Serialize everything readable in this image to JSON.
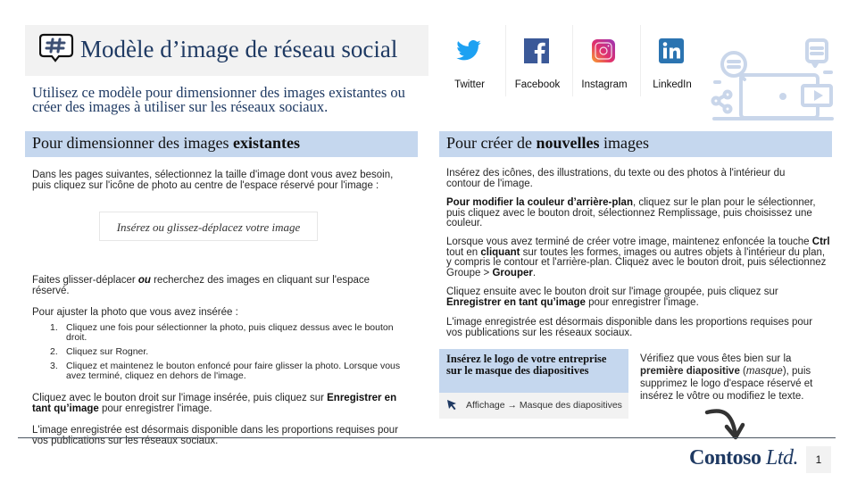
{
  "title": {
    "icon": "hashtag-speech-bubble-icon",
    "text": "Modèle d’image de réseau social"
  },
  "intro": "Utilisez ce modèle pour dimensionner des images existantes ou créer des images à utiliser sur les réseaux sociaux.",
  "left_section": {
    "header_prefix": "Pour dimensionner des images ",
    "header_bold": "existantes",
    "p1": "Dans les pages suivantes, sélectionnez la taille d'image dont vous avez besoin, puis cliquez sur l'icône de photo au centre de l'espace réservé pour l'image :",
    "placeholder_text": "Insérez ou glissez-déplacez votre image",
    "p2_before": "Faites glisser-déplacer ",
    "p2_emph": "ou",
    "p2_after": " recherchez des images en cliquant sur l'espace réservé.",
    "p3": "Pour ajuster la photo que vous avez insérée :",
    "steps": [
      {
        "num": "1.",
        "text": "Cliquez une fois pour sélectionner la photo, puis cliquez dessus avec le bouton droit."
      },
      {
        "num": "2.",
        "text": "Cliquez sur Rogner."
      },
      {
        "num": "3.",
        "text": "Cliquez et maintenez le bouton enfoncé pour faire glisser la photo. Lorsque vous avez terminé, cliquez en dehors de l'image."
      }
    ],
    "p4_before": "Cliquez avec le bouton droit sur l'image insérée, puis cliquez sur ",
    "p4_bold": "Enregistrer en tant qu’image",
    "p4_after": " pour enregistrer l'image.",
    "p5": "L'image enregistrée est désormais disponible dans les proportions requises pour vos publications sur les réseaux sociaux."
  },
  "social": [
    {
      "name": "Twitter",
      "icon": "twitter-icon",
      "color": "#1da1f2"
    },
    {
      "name": "Facebook",
      "icon": "facebook-icon",
      "color": "#3b5998"
    },
    {
      "name": "Instagram",
      "icon": "instagram-icon",
      "color": "#e1306c"
    },
    {
      "name": "LinkedIn",
      "icon": "linkedin-icon",
      "color": "#2b74b1"
    }
  ],
  "right_section": {
    "header_prefix": "Pour créer de ",
    "header_bold": "nouvelles",
    "header_suffix": " images",
    "p1": "Insérez des icônes, des illustrations, du texte ou des photos à l'intérieur du contour de l'image.",
    "p2_bold": "Pour modifier la couleur d’arrière-plan",
    "p2_after": ", cliquez sur le plan pour le sélectionner, puis cliquez avec le bouton droit, sélectionnez Remplissage, puis choisissez une couleur.",
    "p3_a": "Lorsque vous avez terminé de créer votre image, maintenez enfoncée la touche ",
    "p3_ctrl": "Ctrl",
    "p3_b": " tout en ",
    "p3_cliquant": "cliquant",
    "p3_c": " sur toutes les formes, images ou autres objets à l'intérieur du plan, y compris le contour et l'arrière-plan. Cliquez avec le bouton droit, puis sélectionnez Groupe > ",
    "p3_grouper": "Grouper",
    "p3_d": ".",
    "p4_before": "Cliquez ensuite avec le bouton droit sur l'image groupée, puis cliquez sur ",
    "p4_bold": "Enregistrer en tant qu’image",
    "p4_after": " pour enregistrer l'image.",
    "p5": "L'image enregistrée est désormais disponible dans les proportions requises pour vos publications sur les réseaux sociaux."
  },
  "logo_box": {
    "header": "Insérez le logo de votre entreprise sur le masque des diapositives",
    "path": "Affichage → Masque des diapositives"
  },
  "verify": {
    "a": "Vérifiez que vous êtes bien sur la ",
    "bold": "première diapositive",
    "b": " (",
    "italic": "masque",
    "c": "), puis supprimez le logo d'espace réservé et insérez le vôtre ou modifiez le texte."
  },
  "footer": {
    "logo_main": "Contoso",
    "logo_suffix": " Ltd.",
    "page_number": "1"
  },
  "colors": {
    "title_text": "#1f3a63",
    "section_header_bg": "#c5d7ee",
    "banner_bg": "#f2f2f2",
    "illustration": "#c9d6ea"
  }
}
